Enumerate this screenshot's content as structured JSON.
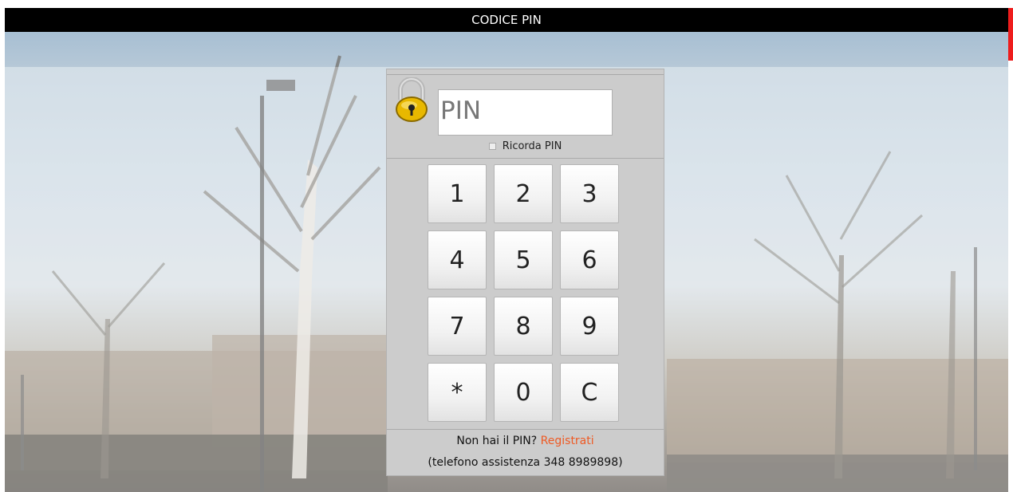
{
  "header": {
    "title": "CODICE PIN"
  },
  "pin": {
    "placeholder": "PIN",
    "remember_label": "Ricorda PIN"
  },
  "keypad": {
    "keys": [
      "1",
      "2",
      "3",
      "4",
      "5",
      "6",
      "7",
      "8",
      "9",
      "*",
      "0",
      "C"
    ]
  },
  "footer": {
    "no_pin_text": "Non hai il PIN?",
    "register_link": "Registrati",
    "support_text": "(telefono assistenza 348 8989898)"
  },
  "colors": {
    "header_bg": "#000000",
    "accent_red": "#ee1c1c",
    "link_orange": "#ee5a24",
    "lock_gold": "#e8b800"
  }
}
